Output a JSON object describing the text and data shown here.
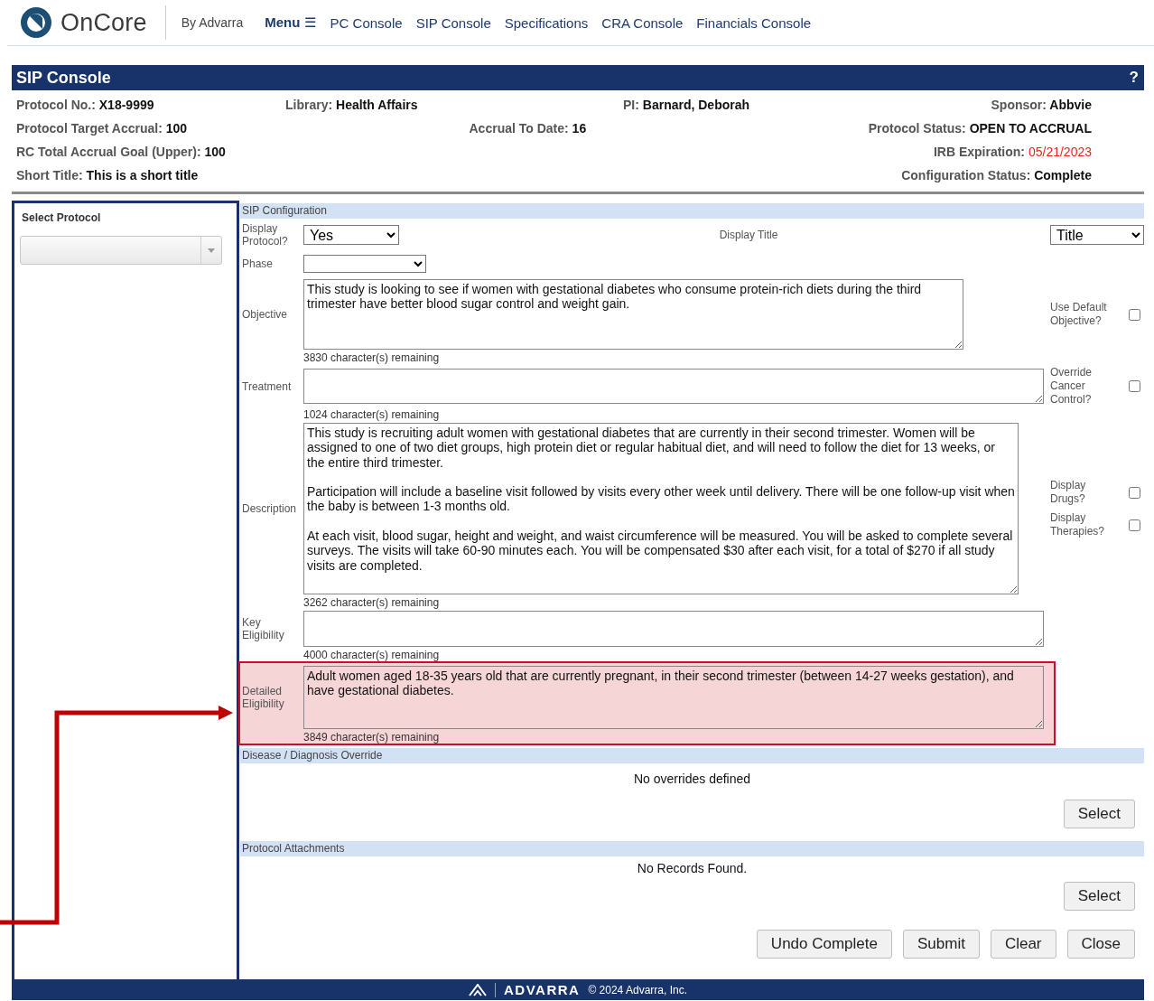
{
  "header": {
    "logo": "OnCore",
    "byline": "By Advarra",
    "menu": {
      "label": "Menu",
      "icon": "☰"
    },
    "nav": [
      "PC Console",
      "SIP Console",
      "Specifications",
      "CRA Console",
      "Financials Console"
    ]
  },
  "console": {
    "title": "SIP Console",
    "help": "?",
    "info_rows": [
      [
        {
          "label": "Protocol No.:",
          "value": "X18-9999",
          "alert": false
        },
        {
          "label": "Library:",
          "value": "Health Affairs",
          "alert": false
        },
        {
          "label": "PI:",
          "value": "Barnard, Deborah",
          "alert": false
        },
        {
          "label": "Sponsor:",
          "value": "Abbvie",
          "alert": false
        }
      ],
      [
        {
          "label": "Protocol Target Accrual:",
          "value": "100",
          "alert": false
        },
        {
          "label": "Accrual To Date:",
          "value": "16",
          "alert": false
        },
        {
          "label": "Protocol Status:",
          "value": "OPEN TO ACCRUAL",
          "alert": false
        }
      ],
      [
        {
          "label": "RC Total Accrual Goal (Upper):",
          "value": "100",
          "alert": false
        },
        {
          "label": "IRB Expiration:",
          "value": "05/21/2023",
          "alert": true
        }
      ],
      [
        {
          "label": "Short Title:",
          "value": "This is a short title",
          "alert": false
        },
        {
          "label": "Configuration Status:",
          "value": "Complete",
          "alert": false
        }
      ]
    ]
  },
  "sidebar": {
    "title": "Select Protocol"
  },
  "sip_configuration": {
    "title": "SIP Configuration",
    "display_protocol": {
      "label": "Display Protocol?",
      "value": "Yes"
    },
    "display_title": {
      "label": "Display Title",
      "value": "Title"
    },
    "phase": {
      "label": "Phase"
    },
    "text_fields": [
      {
        "label": "Objective",
        "value": "This study is looking to see if women with gestational diabetes who consume protein-rich diets during the third trimester have better blood sugar control and weight gain.",
        "remaining": "3830 character(s) remaining",
        "highlighted": false,
        "options": [
          {
            "label": "Use Default Objective?",
            "checked": false
          }
        ]
      },
      {
        "label": "Treatment",
        "remaining": "1024 character(s) remaining",
        "highlighted": false,
        "options": [
          {
            "label": "Override Cancer Control?",
            "checked": false
          }
        ]
      },
      {
        "label": "Description",
        "value": "This study is recruiting adult women with gestational diabetes that are currently in their second trimester. Women will be assigned to one of two diet groups, high protein diet or regular habitual diet, and will need to follow the diet for 13 weeks, or the entire third trimester.\n\nParticipation will include a baseline visit followed by visits every other week until delivery. There will be one follow-up visit when the baby is between 1-3 months old.\n\nAt each visit, blood sugar, height and weight, and waist circumference will be measured. You will be asked to complete several surveys. The visits will take 60-90 minutes each. You will be compensated $30 after each visit, for a total of $270 if all study visits are completed.",
        "remaining": "3262 character(s) remaining",
        "highlighted": false,
        "options": [
          {
            "label": "Display Drugs?",
            "checked": false
          },
          {
            "label": "Display Therapies?",
            "checked": false
          }
        ]
      },
      {
        "label": "Key Eligibility",
        "remaining": "4000 character(s) remaining",
        "highlighted": false
      },
      {
        "label": "Detailed Eligibility",
        "value": "Adult women aged 18-35 years old that are currently pregnant, in their second trimester (between 14-27 weeks gestation), and have gestational diabetes.",
        "remaining": "3849 character(s) remaining",
        "highlighted": true
      }
    ]
  },
  "disease_override": {
    "title": "Disease / Diagnosis Override",
    "empty_text": "No overrides defined",
    "button": "Select"
  },
  "attachments": {
    "title": "Protocol Attachments",
    "empty_text": "No Records Found.",
    "button": "Select"
  },
  "actions": [
    "Undo Complete",
    "Submit",
    "Clear",
    "Close"
  ],
  "footer": {
    "brand": "ADVARRA",
    "copyright": "© 2024 Advarra, Inc."
  }
}
